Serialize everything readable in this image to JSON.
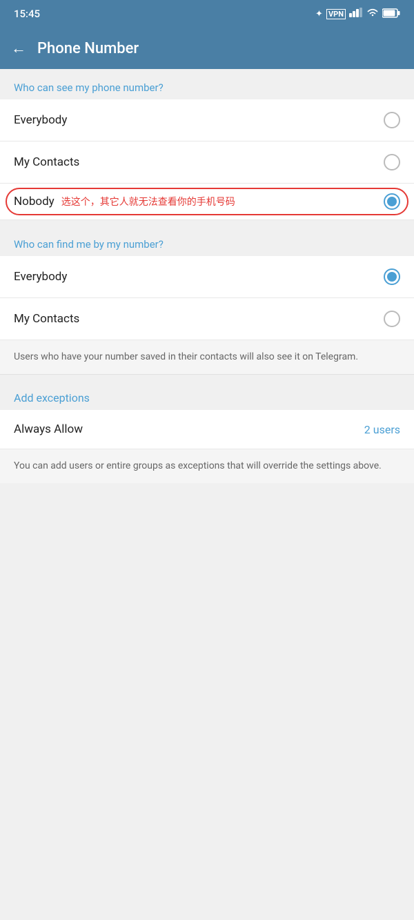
{
  "statusBar": {
    "time": "15:45",
    "bluetooth": "✦",
    "vpn": "VPN",
    "signal": "HD",
    "wifi": "wifi",
    "battery": "71"
  },
  "header": {
    "backLabel": "←",
    "title": "Phone Number"
  },
  "section1": {
    "label": "Who can see my phone number?",
    "options": [
      {
        "id": "everybody1",
        "label": "Everybody",
        "selected": false
      },
      {
        "id": "mycontacts1",
        "label": "My Contacts",
        "selected": false
      },
      {
        "id": "nobody",
        "label": "Nobody",
        "note": "选这个，其它人就无法查看你的手机号码",
        "selected": true
      }
    ]
  },
  "section2": {
    "label": "Who can find me by my number?",
    "options": [
      {
        "id": "everybody2",
        "label": "Everybody",
        "selected": true
      },
      {
        "id": "mycontacts2",
        "label": "My Contacts",
        "selected": false
      }
    ],
    "info": "Users who have your number saved in their contacts will also see it on Telegram."
  },
  "exceptions": {
    "label": "Add exceptions",
    "alwaysAllow": "Always Allow",
    "usersCount": "2 users",
    "info": "You can add users or entire groups as exceptions that will override the settings above."
  }
}
